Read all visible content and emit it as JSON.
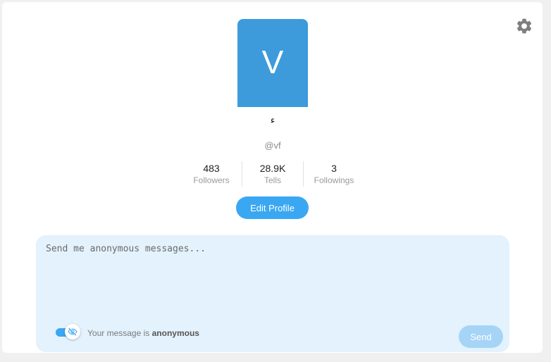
{
  "profile": {
    "avatar_letter": "V",
    "display_name": "ء",
    "handle": "@vf",
    "avatar_color": "#3d9bdb"
  },
  "stats": [
    {
      "value": "483",
      "label": "Followers"
    },
    {
      "value": "28.9K",
      "label": "Tells"
    },
    {
      "value": "3",
      "label": "Followings"
    }
  ],
  "actions": {
    "edit_profile_label": "Edit Profile",
    "settings_icon": "gear-icon"
  },
  "composer": {
    "placeholder": "Send me anonymous messages...",
    "value": "",
    "anon_prefix": "Your message is ",
    "anon_emphasis": "anonymous",
    "anon_enabled": true,
    "anon_icon": "eye-slash-icon",
    "send_label": "Send"
  },
  "colors": {
    "accent": "#3aa7f2",
    "composer_bg": "#e3f2fd",
    "send_disabled": "#a5d4f7"
  }
}
